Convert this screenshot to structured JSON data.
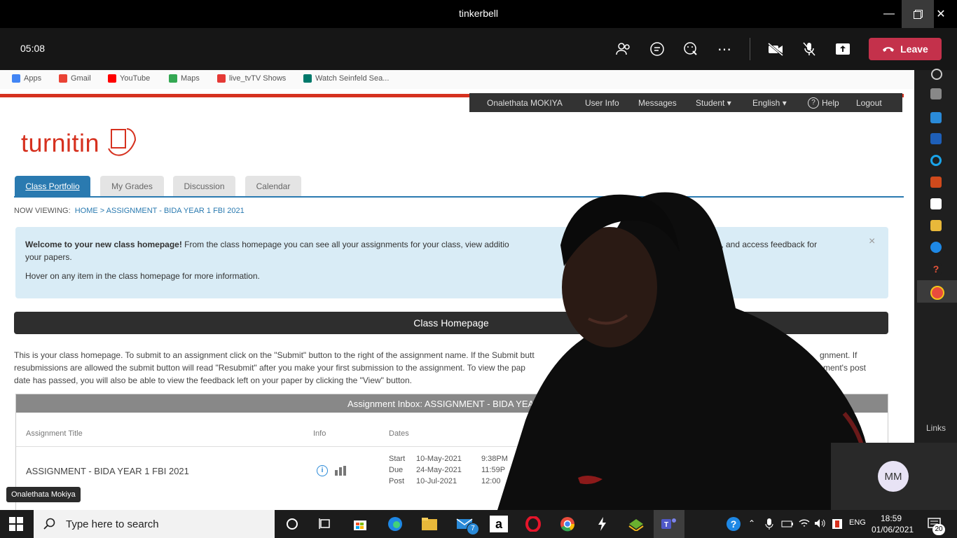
{
  "window": {
    "title": "tinkerbell"
  },
  "meeting": {
    "duration": "05:08",
    "leave_label": "Leave"
  },
  "bookmarks": [
    {
      "label": "Apps",
      "color": "#4285f4"
    },
    {
      "label": "Gmail",
      "color": "#ea4335"
    },
    {
      "label": "YouTube",
      "color": "#ff0000"
    },
    {
      "label": "Maps",
      "color": "#34a853"
    },
    {
      "label": "live_tvTV Shows",
      "color": "#e53935"
    },
    {
      "label": "Watch Seinfeld Sea...",
      "color": "#00796b"
    }
  ],
  "turnitin": {
    "logo_text": "turnitin",
    "topnav": [
      "Onalethata MOKIYA",
      "User Info",
      "Messages",
      "Student ▾",
      "English ▾",
      "Help",
      "Logout"
    ],
    "tabs": [
      "Class Portfolio",
      "My Grades",
      "Discussion",
      "Calendar"
    ],
    "now_viewing_label": "NOW VIEWING:",
    "now_viewing_path": "HOME > ASSIGNMENT - BIDA YEAR 1 FBI 2021",
    "welcome_bold": "Welcome to your new class homepage!",
    "welcome_text": " From the class homepage you can see all your assignments for your class, view additio",
    "welcome_text_tail": "mit your work, and access feedback for",
    "welcome_line2": "your papers.",
    "welcome_line3": "Hover on any item in the class homepage for more information.",
    "class_homepage_title": "Class Homepage",
    "intro_line1": "This is your class homepage. To submit to an assignment click on the \"Submit\" button to the right of the assignment name. If the Submit butt",
    "intro_line1_tail": "gnment. If",
    "intro_line2": "resubmissions are allowed the submit button will read \"Resubmit\" after you make your first submission to the assignment. To view the pap",
    "intro_line2_tail": "ment's post",
    "intro_line3": "date has passed, you will also be able to view the feedback left on your paper by clicking the \"View\" button.",
    "inbox_title": "Assignment Inbox: ASSIGNMENT - BIDA YEAR 1 F",
    "columns": [
      "Assignment Title",
      "Info",
      "Dates"
    ],
    "assignment": {
      "title": "ASSIGNMENT - BIDA YEAR 1 FBI 2021",
      "dates": [
        {
          "label": "Start",
          "date": "10-May-2021",
          "time": "9:38PM"
        },
        {
          "label": "Due",
          "date": "24-May-2021",
          "time": "11:59P"
        },
        {
          "label": "Post",
          "date": "10-Jul-2021",
          "time": "12:00"
        }
      ]
    }
  },
  "participant": {
    "name": "Onalethata Mokiya",
    "initials": "MM"
  },
  "sidebar_link_text": "Links",
  "taskbar": {
    "search_placeholder": "Type here to search",
    "mail_badge": "7",
    "language": "ENG",
    "time": "18:59",
    "date": "01/06/2021",
    "notification_count": "20"
  }
}
